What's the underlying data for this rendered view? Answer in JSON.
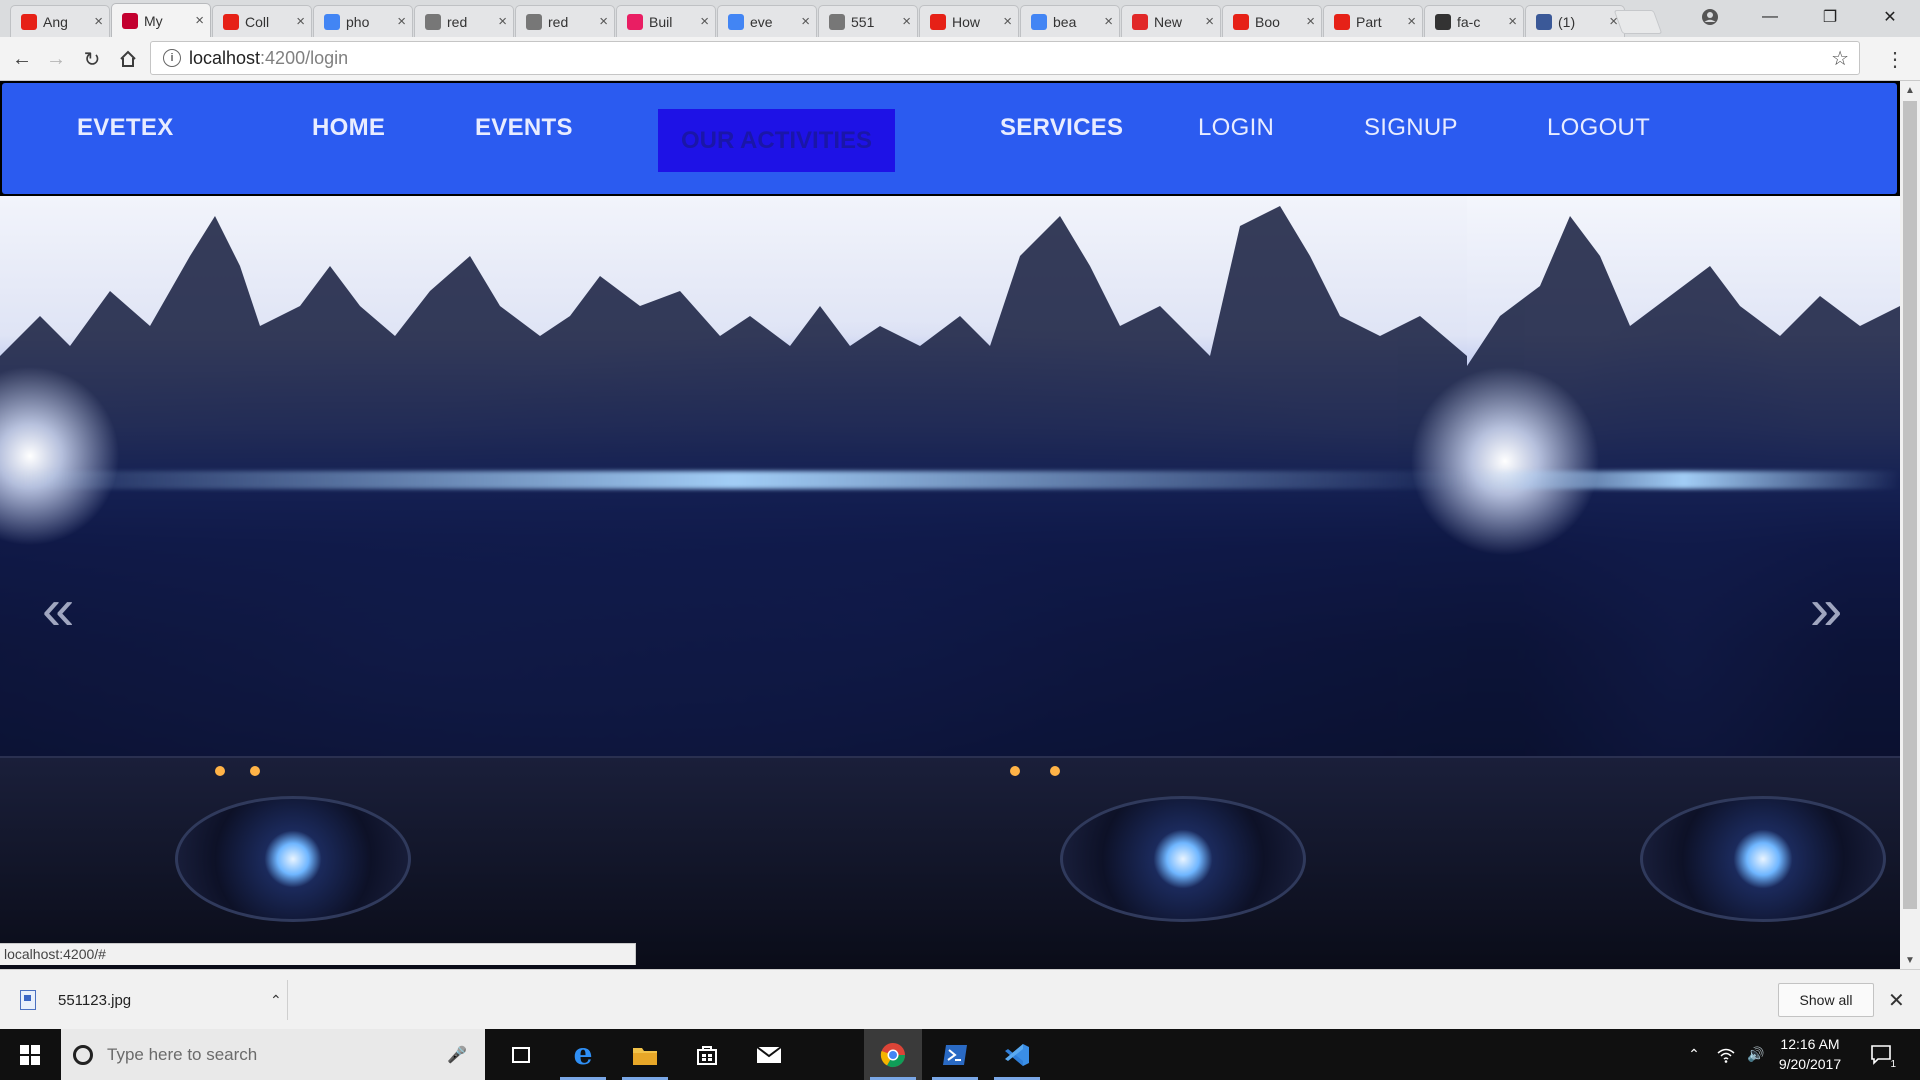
{
  "browser": {
    "tabs": [
      {
        "title": "Ang",
        "favicon": "youtube-icon",
        "color": "#e62117"
      },
      {
        "title": "My",
        "favicon": "angular-icon",
        "color": "#c3002f"
      },
      {
        "title": "Coll",
        "favicon": "youtube-icon",
        "color": "#e62117"
      },
      {
        "title": "pho",
        "favicon": "google-icon",
        "color": "#4285f4"
      },
      {
        "title": "red",
        "favicon": "download-icon",
        "color": "#777777"
      },
      {
        "title": "red",
        "favicon": "download-icon",
        "color": "#777777"
      },
      {
        "title": "Buil",
        "favicon": "play-icon",
        "color": "#e91e63"
      },
      {
        "title": "eve",
        "favicon": "google-icon",
        "color": "#4285f4"
      },
      {
        "title": "551",
        "favicon": "file-icon",
        "color": "#777777"
      },
      {
        "title": "How",
        "favicon": "youtube-icon",
        "color": "#e62117"
      },
      {
        "title": "bea",
        "favicon": "google-icon",
        "color": "#4285f4"
      },
      {
        "title": "New",
        "favicon": "flipboard-icon",
        "color": "#e12828"
      },
      {
        "title": "Boo",
        "favicon": "youtube-icon",
        "color": "#e62117"
      },
      {
        "title": "Part",
        "favicon": "youtube-icon",
        "color": "#e62117"
      },
      {
        "title": "fa-c",
        "favicon": "image-icon",
        "color": "#333333"
      },
      {
        "title": "(1)",
        "favicon": "facebook-icon",
        "color": "#3b5998"
      }
    ],
    "active_tab_index": 1,
    "address": {
      "host": "localhost",
      "path": ":4200/login"
    },
    "status_url": "localhost:4200/#"
  },
  "site": {
    "brand": "EVETEX",
    "nav": {
      "home": "HOME",
      "events": "EVENTS",
      "activities": "OUR ACTIVITIES",
      "services": "SERVICES",
      "login": "LOGIN",
      "signup": "SIGNUP",
      "logout": "LOGOUT"
    },
    "accent_color": "#2b5bf0",
    "active_color": "#1e12e6",
    "carousel": {
      "prev": "«",
      "next": "»"
    }
  },
  "downloads": {
    "file_name": "551123.jpg",
    "show_all": "Show all"
  },
  "taskbar": {
    "search_placeholder": "Type here to search",
    "time": "12:16 AM",
    "date": "9/20/2017",
    "notification_count": "1"
  }
}
